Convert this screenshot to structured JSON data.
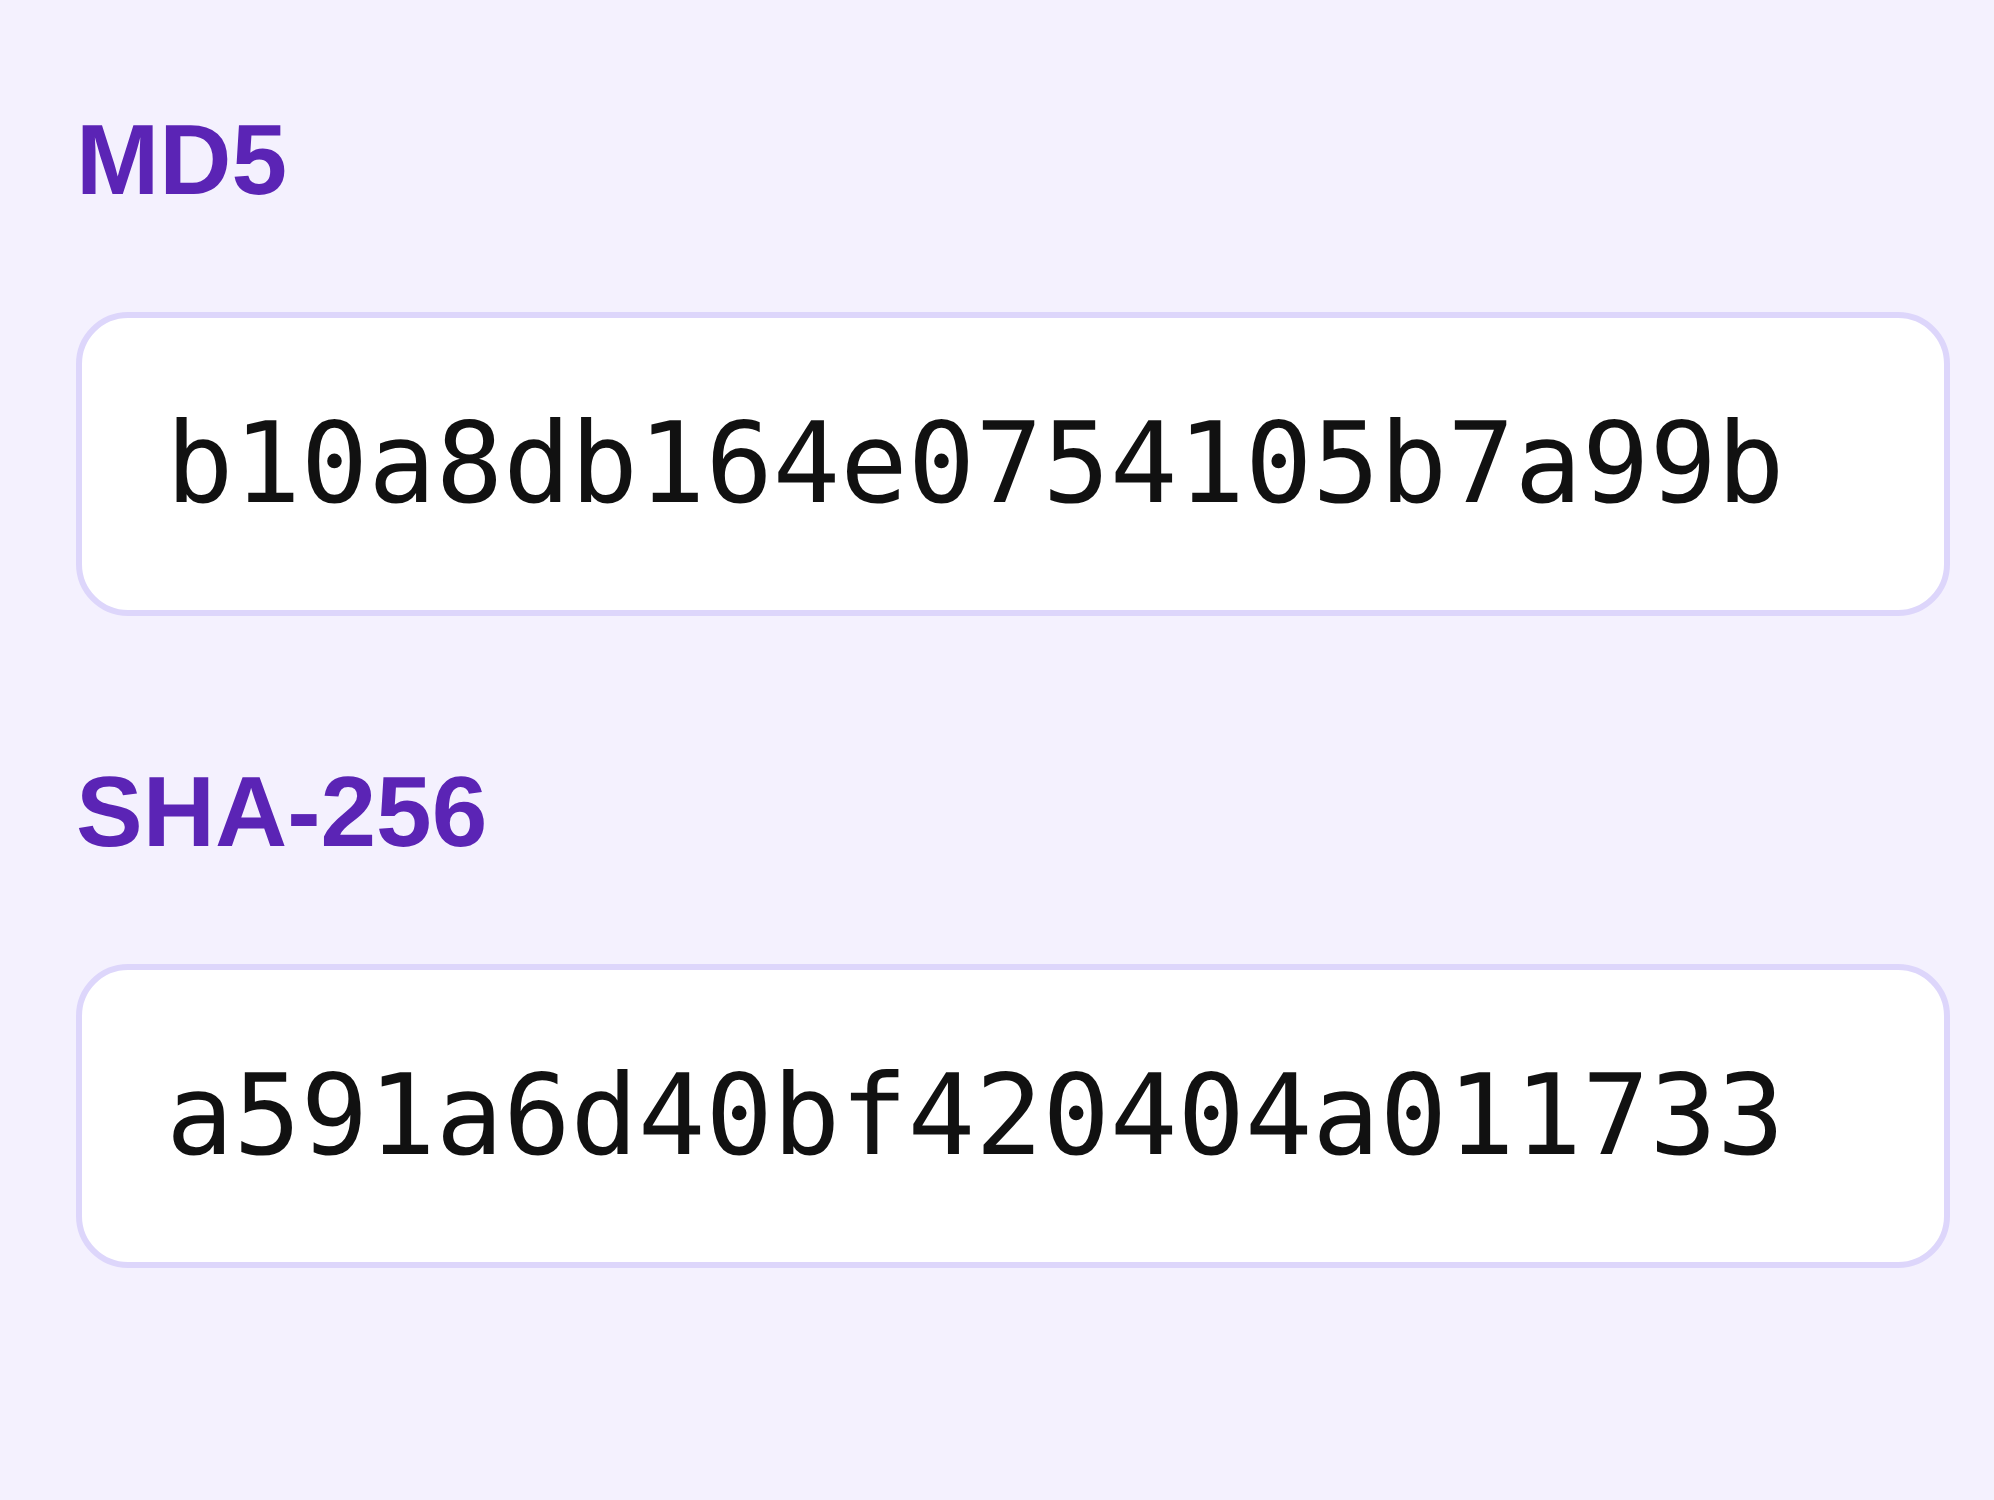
{
  "hashes": [
    {
      "label": "MD5",
      "value": "b10a8db164e0754105b7a99b"
    },
    {
      "label": "SHA-256",
      "value": "a591a6d40bf420404a011733"
    }
  ]
}
